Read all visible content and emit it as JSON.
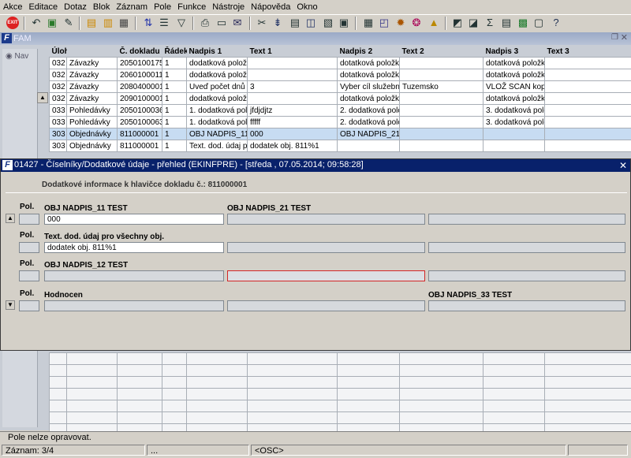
{
  "menu": [
    "Akce",
    "Editace",
    "Dotaz",
    "Blok",
    "Záznam",
    "Pole",
    "Funkce",
    "Nástroje",
    "Nápověda",
    "Okno"
  ],
  "toolbar": {
    "exit_label": "EXIT",
    "icons": [
      "exit-icon",
      "back-icon",
      "save-icon",
      "new-record-icon",
      "delete-record-icon",
      "folder-icon",
      "query-icon",
      "sort-icon",
      "filter-icon",
      "print-icon",
      "preview-icon",
      "mail-icon",
      "cut-icon",
      "copy-icon",
      "paste-icon",
      "edit-icon",
      "image-icon",
      "list-icon",
      "calculator-icon",
      "sun-icon",
      "settings-icon",
      "triangle-icon",
      "report-icon",
      "zoom-icon",
      "chart-icon",
      "sum-icon",
      "excel-icon",
      "clipboard-icon",
      "help-icon"
    ]
  },
  "main": {
    "title": "FAM",
    "nav_label": "Nav",
    "columns": [
      "Úloha",
      "",
      "Č. dokladu",
      "Řádek",
      "Nadpis 1",
      "Text 1",
      "Nadpis 2",
      "Text 2",
      "Nadpis 3",
      "Text 3"
    ],
    "rows": [
      [
        "032",
        "Závazky",
        "2050100175",
        "1",
        "dodatková položka",
        "",
        "dotatková položka č",
        "",
        "dotatková položka s",
        ""
      ],
      [
        "032",
        "Závazky",
        "2060100011",
        "1",
        "dodatková položka",
        "",
        "dotatková položka č",
        "",
        "dotatková položka s",
        ""
      ],
      [
        "032",
        "Závazky",
        "2080400001",
        "1",
        "Uveď počet dnů sl.c",
        "3",
        "Vyber cíl služební c",
        "Tuzemsko",
        "VLOŽ SCAN kopie c",
        ""
      ],
      [
        "032",
        "Závazky",
        "2090100001",
        "1",
        "dodatková položka",
        "",
        "dotatková položka č",
        "",
        "dotatková položka s",
        ""
      ],
      [
        "033",
        "Pohledávky",
        "2050100036",
        "1",
        "1. dodatková polož",
        "jfdjdjtz",
        "2. dodatková polož",
        "",
        "3. dodatková polož",
        ""
      ],
      [
        "033",
        "Pohledávky",
        "2050100063",
        "1",
        "1. dodatková polož",
        "fffff",
        "2. dodatková polož",
        "",
        "3. dodatková polož",
        ""
      ],
      [
        "303",
        "Objednávky",
        "811000001",
        "1",
        "OBJ NADPIS_11 TE",
        "000",
        "OBJ NADPIS_21 TE",
        "",
        "",
        ""
      ],
      [
        "303",
        "Objednávky",
        "811000001",
        "1",
        "Text. dod. údaj pro",
        "dodatek obj. 811%1",
        "",
        "",
        "",
        ""
      ]
    ],
    "selected_row": 6
  },
  "dialog": {
    "title": "01427 - Číselníky/Dodatkové údaje - přehled (EKINFPRE) - [středa , 07.05.2014; 09:58:28]",
    "header": "Dodatkové informace k hlavičce dokladu č.: 811000001",
    "pol_label": "Pol.",
    "blocks": [
      {
        "label1": "OBJ NADPIS_11 TEST",
        "label2": "OBJ NADPIS_21 TEST",
        "label3": "",
        "value1": "000",
        "value2": "",
        "value3": ""
      },
      {
        "label1": "Text. dod. údaj pro všechny obj.",
        "label2": "",
        "label3": "",
        "value1": "dodatek obj. 811%1",
        "value2": "",
        "value3": ""
      },
      {
        "label1": "OBJ NADPIS_12 TEST",
        "label2": "",
        "label3": "",
        "value1": "",
        "value2": "",
        "value3": ""
      },
      {
        "label1": "Hodnocen",
        "label2": "",
        "label3": "OBJ NADPIS_33 TEST",
        "value1": "",
        "value2": "",
        "value3": ""
      }
    ]
  },
  "status": {
    "message": "Pole nelze opravovat.",
    "record": "Záznam: 3/4",
    "seg2": "...",
    "mode": "<OSC>"
  }
}
